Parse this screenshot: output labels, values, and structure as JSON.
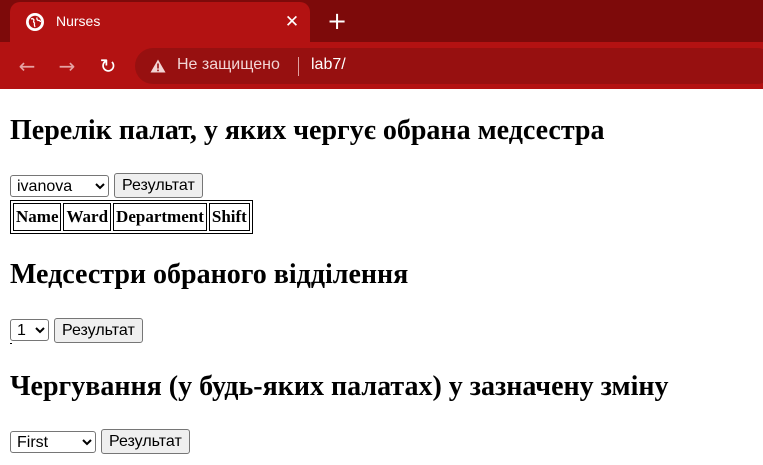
{
  "browser": {
    "tab_title": "Nurses",
    "tab_close_glyph": "✕",
    "new_tab_glyph": "+",
    "back_glyph": "←",
    "forward_glyph": "→",
    "reload_glyph": "↻",
    "security_label": "Не защищено",
    "url": "lab7/",
    "chrome_color": "#b31212"
  },
  "section1": {
    "title": "Перелік палат, у яких чергує обрана медсестра",
    "select_value": "ivanova",
    "button_label": "Результат",
    "table_headers": [
      "Name",
      "Ward",
      "Department",
      "Shift"
    ]
  },
  "section2": {
    "title": "Медсестри обраного відділення",
    "select_value": "1",
    "button_label": "Результат"
  },
  "section3": {
    "title": "Чергування (у будь-яких палатах) у зазначену зміну",
    "select_value": "First",
    "button_label": "Результат"
  }
}
